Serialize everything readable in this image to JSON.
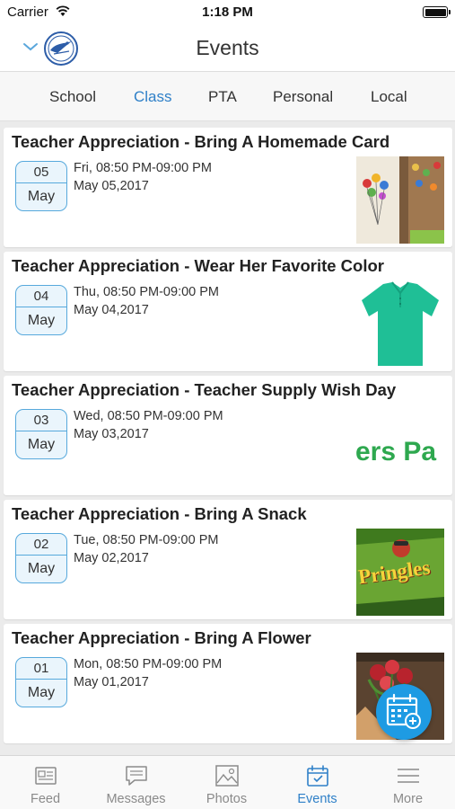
{
  "status": {
    "carrier": "Carrier",
    "time": "1:18 PM"
  },
  "nav": {
    "title": "Events"
  },
  "category_tabs": [
    "School",
    "Class",
    "PTA",
    "Personal",
    "Local"
  ],
  "active_category": "Class",
  "events": [
    {
      "title": "Teacher Appreciation - Bring A Homemade Card",
      "day": "05",
      "month": "May",
      "time": "Fri, 08:50 PM-09:00 PM",
      "date": "May 05,2017"
    },
    {
      "title": "Teacher Appreciation - Wear Her Favorite Color",
      "day": "04",
      "month": "May",
      "time": "Thu, 08:50 PM-09:00 PM",
      "date": "May 04,2017"
    },
    {
      "title": "Teacher Appreciation - Teacher Supply Wish Day",
      "day": "03",
      "month": "May",
      "time": "Wed, 08:50 PM-09:00 PM",
      "date": "May 03,2017",
      "image_text": "ers Pa"
    },
    {
      "title": "Teacher Appreciation - Bring A Snack",
      "day": "02",
      "month": "May",
      "time": "Tue, 08:50 PM-09:00 PM",
      "date": "May 02,2017",
      "image_text": "Pringles"
    },
    {
      "title": "Teacher Appreciation - Bring A Flower",
      "day": "01",
      "month": "May",
      "time": "Mon, 08:50 PM-09:00 PM",
      "date": "May 01,2017"
    }
  ],
  "bottom_tabs": [
    {
      "label": "Feed",
      "icon": "feed-icon"
    },
    {
      "label": "Messages",
      "icon": "messages-icon"
    },
    {
      "label": "Photos",
      "icon": "photos-icon"
    },
    {
      "label": "Events",
      "icon": "events-icon"
    },
    {
      "label": "More",
      "icon": "more-icon"
    }
  ],
  "active_bottom_tab": "Events",
  "colors": {
    "accent": "#2f80c8",
    "fab": "#1e9be3",
    "badge_border": "#57a9dc",
    "background": "#ebebeb"
  }
}
